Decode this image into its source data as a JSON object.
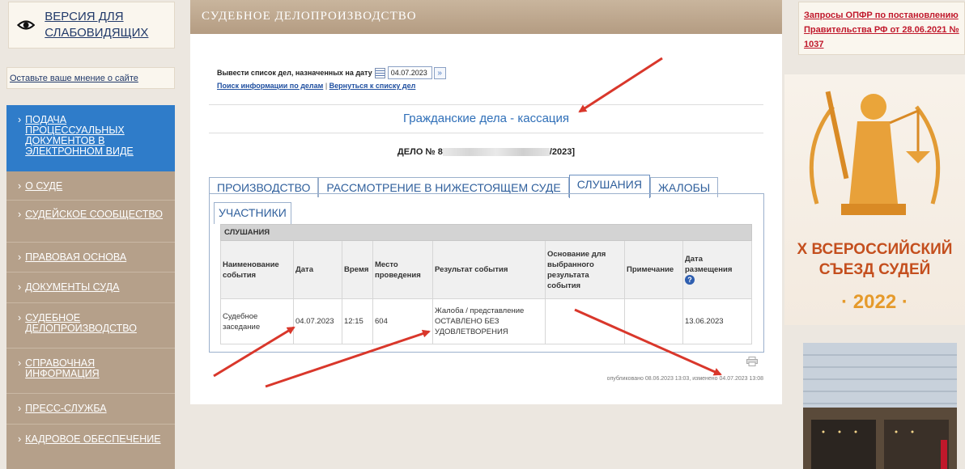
{
  "vision": {
    "label": "ВЕРСИЯ ДЛЯ СЛАБОВИДЯЩИХ",
    "icon": "eye-icon"
  },
  "opinion": {
    "label": "Оставьте ваше мнение о сайте"
  },
  "menu": [
    {
      "label": "ПОДАЧА ПРОЦЕССУАЛЬНЫХ ДОКУМЕНТОВ В ЭЛЕКТРОННОМ ВИДЕ",
      "active": true
    },
    {
      "label": "О СУДЕ"
    },
    {
      "label": "СУДЕЙСКОЕ СООБЩЕСТВО"
    },
    {
      "label": "ПРАВОВАЯ ОСНОВА"
    },
    {
      "label": "ДОКУМЕНТЫ СУДА"
    },
    {
      "label": "СУДЕБНОЕ ДЕЛОПРОИЗВОДСТВО"
    },
    {
      "label": "СПРАВОЧНАЯ ИНФОРМАЦИЯ"
    },
    {
      "label": "ПРЕСС-СЛУЖБА"
    },
    {
      "label": "КАДРОВОЕ ОБЕСПЕЧЕНИЕ"
    }
  ],
  "main": {
    "header": "СУДЕБНОЕ ДЕЛОПРОИЗВОДСТВО",
    "date_label": "Вывести список дел, назначенных на дату",
    "date_value": "04.07.2023",
    "link_search": "Поиск информации по делам",
    "link_back": "Вернуться к списку дел",
    "separator": "|",
    "section_title": "Гражданские дела - кассация",
    "case_prefix": "ДЕЛО № 8",
    "case_suffix": "/2023]",
    "tabs": [
      "ПРОИЗВОДСТВО",
      "РАССМОТРЕНИЕ В НИЖЕСТОЯЩЕМ СУДЕ",
      "СЛУШАНИЯ",
      "ЖАЛОБЫ"
    ],
    "subtab": "УЧАСТНИКИ",
    "table": {
      "caption": "СЛУШАНИЯ",
      "headers": [
        "Наименование события",
        "Дата",
        "Время",
        "Место проведения",
        "Результат события",
        "Основание для выбранного результата события",
        "Примечание",
        "Дата размещения"
      ],
      "rows": [
        [
          "Судебное заседание",
          "04.07.2023",
          "12:15",
          "604",
          "Жалоба / представление ОСТАВЛЕНО БЕЗ УДОВЛЕТВОРЕНИЯ",
          "",
          "",
          "13.06.2023"
        ]
      ]
    },
    "published": "опубликовано 08.06.2023 13:03, изменено 04.07.2023 13:08"
  },
  "right": {
    "opfr_link": "Запросы ОПФР по постановлению Правительства РФ от 28.06.2021 № 1037",
    "banner_line1": "X ВСЕРОССИЙСКИЙ",
    "banner_line2": "СЪЕЗД СУДЕЙ",
    "banner_year": "· 2022 ·"
  },
  "colors": {
    "accent_blue": "#2f7cc9",
    "menu_brown": "#b5a08a",
    "arrow_red": "#d9372b",
    "title_blue": "#2f6fb8"
  }
}
